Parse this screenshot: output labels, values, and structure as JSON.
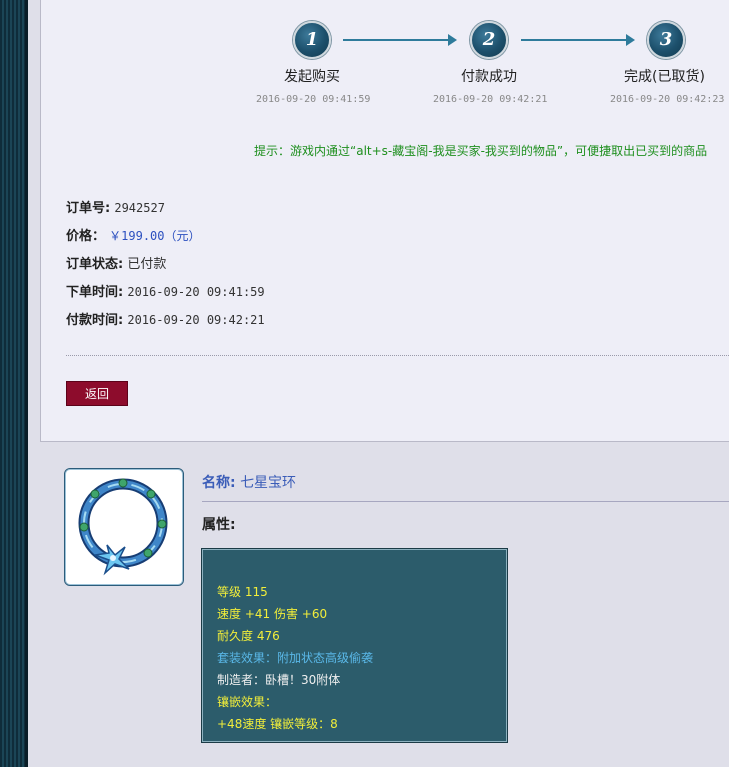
{
  "steps": [
    {
      "number": "1",
      "label": "发起购买",
      "time": "2016-09-20 09:41:59"
    },
    {
      "number": "2",
      "label": "付款成功",
      "time": "2016-09-20 09:42:21"
    },
    {
      "number": "3",
      "label": "完成(已取货)",
      "time": "2016-09-20 09:42:23"
    }
  ],
  "tip": "提示：游戏内通过“alt+s-藏宝阁-我是买家-我买到的物品”，可便捷取出已买到的商品",
  "order": {
    "id_label": "订单号:",
    "id_value": "2942527",
    "price_label": "价格：",
    "price_value": "￥199.00（元）",
    "status_label": "订单状态:",
    "status_value": "已付款",
    "order_time_label": "下单时间:",
    "order_time_value": "2016-09-20 09:41:59",
    "pay_time_label": "付款时间:",
    "pay_time_value": "2016-09-20 09:42:21"
  },
  "back_button": "返回",
  "item": {
    "name_label": "名称:",
    "name_value": "七星宝环",
    "attr_label": "属性:",
    "lines": {
      "level": "等级 115",
      "speed_damage": "速度 +41 伤害 +60",
      "durability": "耐久度 476",
      "set_effect": "套装效果：附加状态高级偷袭",
      "maker": "制造者：卧槽！30附体",
      "inlay_label": "镶嵌效果：",
      "inlay_value": "+48速度 镶嵌等级：8"
    }
  },
  "colors": {
    "button_bg": "#8d0c2c",
    "tip_green": "#1e8f1e",
    "price_blue": "#2b4fbf",
    "attr_box_bg": "#2c5c6b",
    "attr_yellow": "#f2ee3a",
    "attr_blue": "#5ab8e8"
  },
  "icons": {
    "item_icon": "ring-icon"
  }
}
